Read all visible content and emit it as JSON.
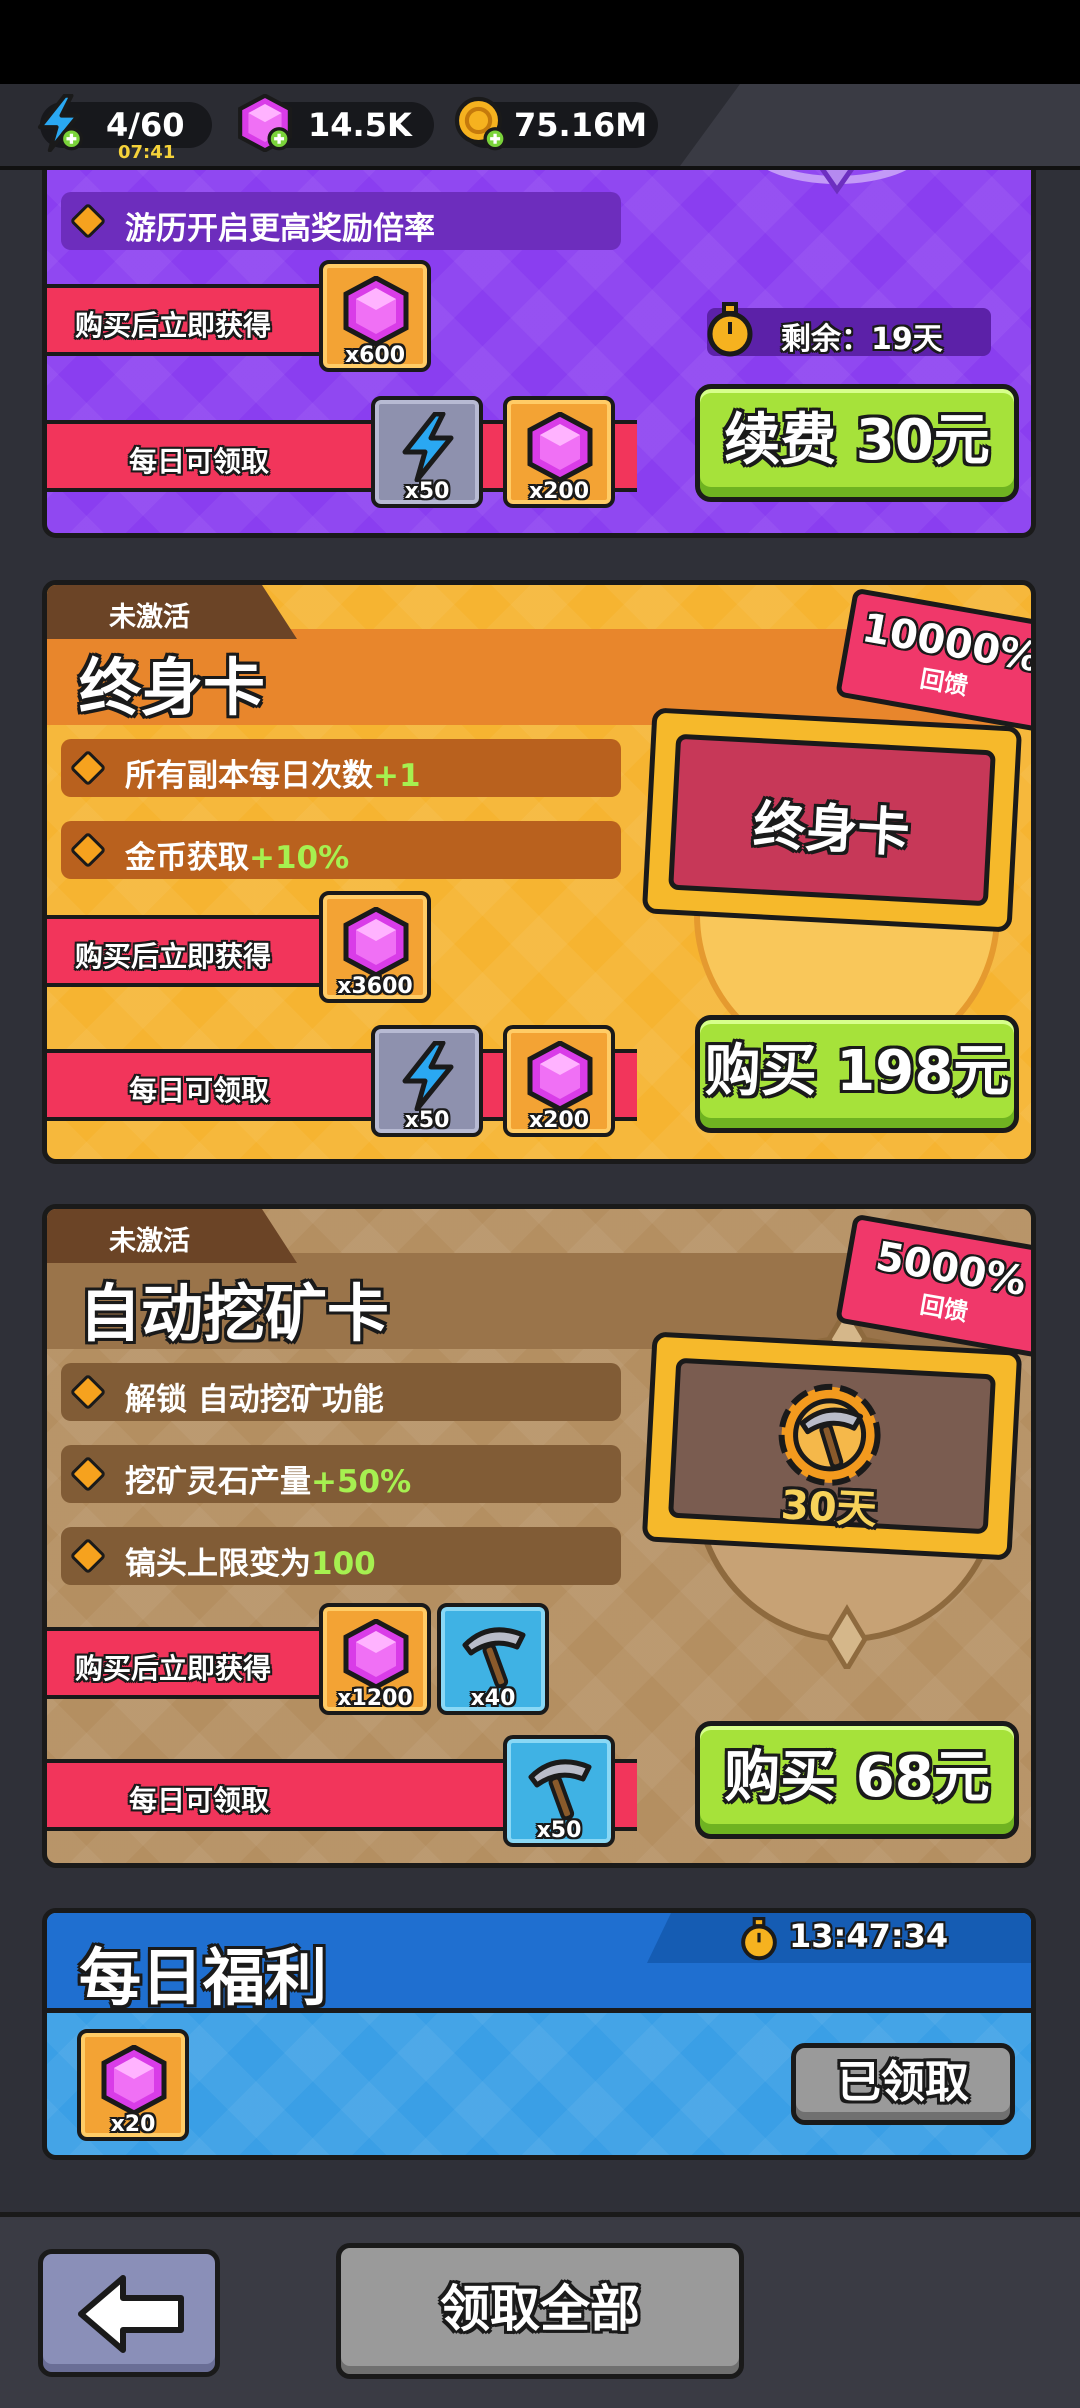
{
  "topbar": {
    "energy": {
      "value": "4/60",
      "timer": "07:41"
    },
    "gems": {
      "value": "14.5K"
    },
    "coins": {
      "value": "75.16M"
    }
  },
  "panels": {
    "monthly": {
      "feature_1": "游历开启更高奖励倍率",
      "buy_label": "购买后立即获得",
      "daily_label": "每日可领取",
      "buy_rewards": [
        {
          "icon": "gem-icon",
          "count": "x600"
        }
      ],
      "daily_rewards": [
        {
          "icon": "lightning-icon",
          "count": "x50"
        },
        {
          "icon": "gem-icon",
          "count": "x200"
        }
      ],
      "remaining": "剩余：19天",
      "button": "续费 30元"
    },
    "lifetime": {
      "tag": "未激活",
      "title": "终身卡",
      "feature_1": "所有副本每日次数",
      "feature_1_hl": "+1",
      "feature_2": "金币获取",
      "feature_2_hl": "+10%",
      "buy_label": "购买后立即获得",
      "daily_label": "每日可领取",
      "buy_rewards": [
        {
          "icon": "gem-icon",
          "count": "x3600"
        }
      ],
      "daily_rewards": [
        {
          "icon": "lightning-icon",
          "count": "x50"
        },
        {
          "icon": "gem-icon",
          "count": "x200"
        }
      ],
      "card_text": "终身卡",
      "badge_value": "10000%",
      "badge_label": "回馈",
      "button": "购买 198元"
    },
    "mining": {
      "tag": "未激活",
      "title": "自动挖矿卡",
      "feature_1": "解锁 自动挖矿功能",
      "feature_2": "挖矿灵石产量",
      "feature_2_hl": "+50%",
      "feature_3": "镐头上限变为",
      "feature_3_hl": "100",
      "buy_label": "购买后立即获得",
      "daily_label": "每日可领取",
      "buy_rewards": [
        {
          "icon": "gem-icon",
          "count": "x1200"
        },
        {
          "icon": "pickaxe-icon",
          "count": "x40"
        }
      ],
      "daily_rewards": [
        {
          "icon": "pickaxe-icon",
          "count": "x50"
        }
      ],
      "card_text": "30天",
      "badge_value": "5000%",
      "badge_label": "回馈",
      "button": "购买 68元"
    },
    "daily": {
      "title": "每日福利",
      "timer": "13:47:34",
      "rewards": [
        {
          "icon": "gem-icon",
          "count": "x20"
        }
      ],
      "button": "已领取"
    }
  },
  "bottom": {
    "back_icon": "arrow-left-icon",
    "claim_all": "领取全部"
  },
  "colors": {
    "purple_panel": "#8a3ef0",
    "orange_panel": "#f6b431",
    "brown_panel": "#b48f61",
    "blue_panel": "#3a9fe6",
    "green_button": "#a6e23a",
    "ribbon_red": "#f2355b"
  }
}
